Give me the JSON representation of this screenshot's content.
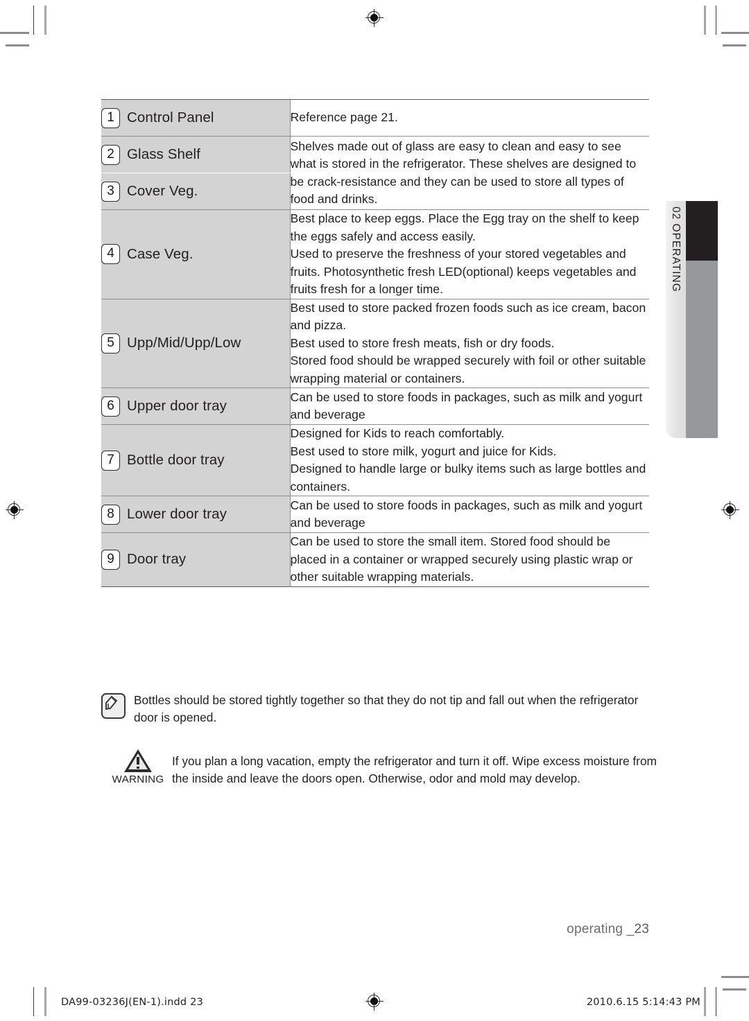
{
  "table": {
    "rows": [
      {
        "number": "1",
        "name": "Control Panel",
        "description": "Reference page 21."
      },
      {
        "number": "2",
        "name": "Glass Shelf",
        "description": "Shelves made out of glass are easy to clean and easy to see what is stored in the refrigerator. These shelves are designed to be crack-resistance and they can be used to store all types of food and drinks."
      },
      {
        "number": "3",
        "name": "Cover Veg.",
        "description": ""
      },
      {
        "number": "4",
        "name": "Case Veg.",
        "description": "Best place to keep eggs. Place the Egg tray on the shelf to keep the eggs safely and access easily.\nUsed to preserve the freshness of your stored vegetables and fruits. Photosynthetic fresh LED(optional) keeps vegetables and fruits fresh for a longer time."
      },
      {
        "number": "5",
        "name": "Upp/Mid/Upp/Low",
        "description": "Best used to store packed frozen foods such as ice cream, bacon and pizza.\nBest used to store fresh meats, fish or dry foods.\nStored food should be wrapped securely with foil or other suitable wrapping material or containers."
      },
      {
        "number": "6",
        "name": "Upper door tray",
        "description": "Can be used to store foods in packages, such as milk and yogurt and beverage"
      },
      {
        "number": "7",
        "name": "Bottle door tray",
        "description": "Designed for Kids to reach comfortably.\nBest used to store milk, yogurt and juice for Kids.\nDesigned to handle large or bulky items such as large bottles and containers."
      },
      {
        "number": "8",
        "name": "Lower door tray",
        "description": "Can be used to store foods in packages, such as milk and yogurt and beverage"
      },
      {
        "number": "9",
        "name": "Door tray",
        "description": "Can be used to store the small item. Stored food should be placed in a container or wrapped securely using plastic wrap or other suitable wrapping materials."
      }
    ]
  },
  "note": {
    "text": "Bottles should be stored tightly together so that they do not tip and fall out when the refrigerator door is opened."
  },
  "warning": {
    "caption": "WARNING",
    "text": "If you plan a long vacation,  empty the refrigerator and turn it off. Wipe excess moisture from the inside and leave the doors open. Otherwise, odor and mold may develop."
  },
  "side_tab": {
    "label": "02 OPERATING"
  },
  "footer": {
    "page_label": "operating _",
    "page_number": "23",
    "print_file": "DA99-03236J(EN-1).indd   23",
    "print_timestamp": "2010.6.15   5:14:43 PM"
  },
  "colors": {
    "name_cell_bg": "#d3d3d3",
    "tab_dark": "#231f20",
    "tab_gray": "#96999b",
    "page_number": "#6d6e71"
  }
}
